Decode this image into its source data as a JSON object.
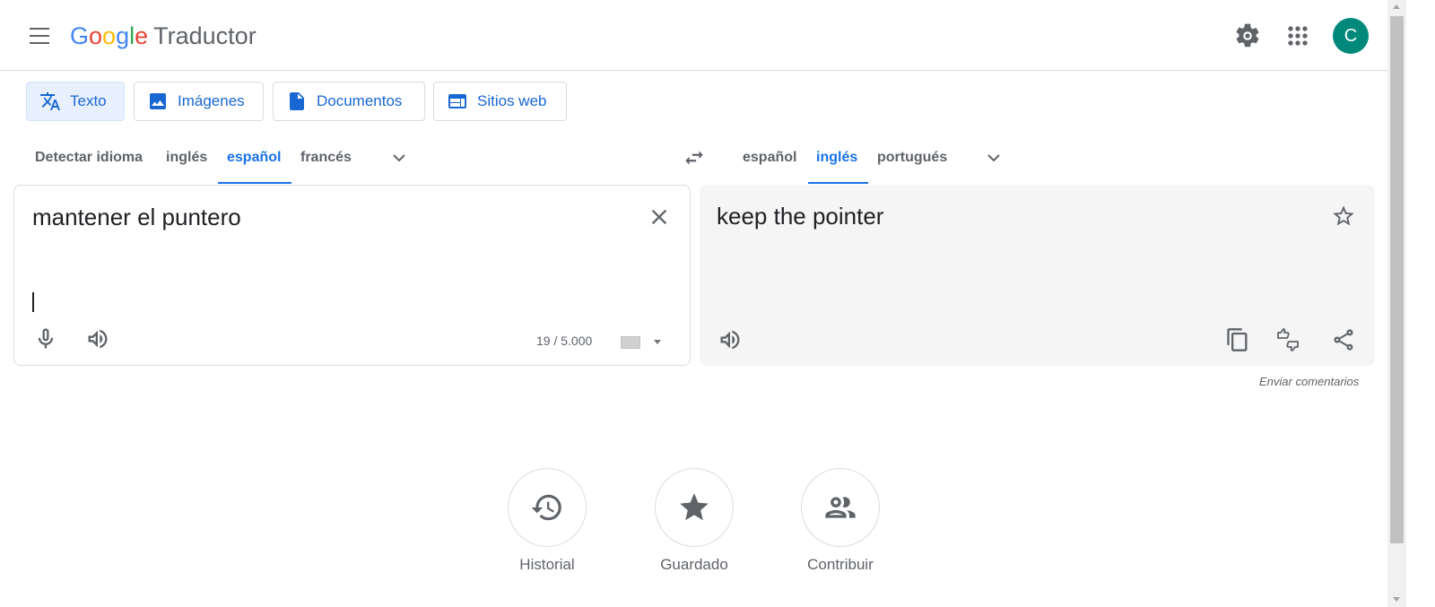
{
  "header": {
    "logo": {
      "g1": "G",
      "o1": "o",
      "o2": "o",
      "g2": "g",
      "l": "l",
      "e": "e",
      "product": "Traductor"
    },
    "avatar_letter": "C",
    "avatar_color": "#00897b"
  },
  "mode_tabs": [
    {
      "label": "Texto",
      "icon": "translate-icon",
      "active": true
    },
    {
      "label": "Imágenes",
      "icon": "image-icon",
      "active": false
    },
    {
      "label": "Documentos",
      "icon": "document-icon",
      "active": false
    },
    {
      "label": "Sitios web",
      "icon": "website-icon",
      "active": false
    }
  ],
  "source_languages": [
    "Detectar idioma",
    "inglés",
    "español",
    "francés"
  ],
  "source_selected": "español",
  "target_languages": [
    "español",
    "inglés",
    "portugués"
  ],
  "target_selected": "inglés",
  "source": {
    "text": "mantener el puntero",
    "char_count": "19 / 5.000"
  },
  "target": {
    "text": "keep the pointer"
  },
  "feedback_label": "Enviar comentarios",
  "bottom_actions": [
    {
      "label": "Historial",
      "icon": "history-icon"
    },
    {
      "label": "Guardado",
      "icon": "star-filled-icon"
    },
    {
      "label": "Contribuir",
      "icon": "people-icon"
    }
  ],
  "colors": {
    "accent": "#1a73e8",
    "active_tab_bg": "#e8f0fe",
    "target_panel_bg": "#f5f5f5"
  }
}
